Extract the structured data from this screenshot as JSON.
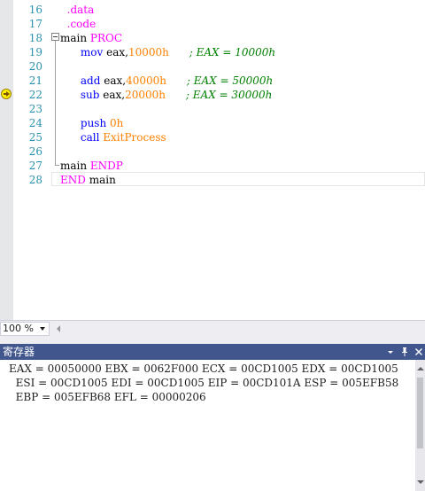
{
  "editor": {
    "lines": [
      {
        "no": "16",
        "parts": [
          {
            "t": "  ",
            "c": "tx"
          },
          {
            "t": ".data",
            "c": "pr"
          }
        ]
      },
      {
        "no": "17",
        "parts": [
          {
            "t": "  ",
            "c": "tx"
          },
          {
            "t": ".code",
            "c": "pr"
          }
        ]
      },
      {
        "no": "18",
        "parts": [
          {
            "t": "main ",
            "c": "tx"
          },
          {
            "t": "PROC",
            "c": "pr"
          }
        ]
      },
      {
        "no": "19",
        "parts": [
          {
            "t": "      ",
            "c": "tx"
          },
          {
            "t": "mov",
            "c": "kw"
          },
          {
            "t": " eax,",
            "c": "tx"
          },
          {
            "t": "10000h",
            "c": "num"
          },
          {
            "t": "      ",
            "c": "tx"
          },
          {
            "t": "; EAX = 10000h",
            "c": "cm"
          }
        ]
      },
      {
        "no": "20",
        "parts": []
      },
      {
        "no": "21",
        "parts": [
          {
            "t": "      ",
            "c": "tx"
          },
          {
            "t": "add",
            "c": "kw"
          },
          {
            "t": " eax,",
            "c": "tx"
          },
          {
            "t": "40000h",
            "c": "num"
          },
          {
            "t": "      ",
            "c": "tx"
          },
          {
            "t": "; EAX = 50000h",
            "c": "cm"
          }
        ]
      },
      {
        "no": "22",
        "parts": [
          {
            "t": "      ",
            "c": "tx"
          },
          {
            "t": "sub",
            "c": "kw"
          },
          {
            "t": " eax,",
            "c": "tx"
          },
          {
            "t": "20000h",
            "c": "num"
          },
          {
            "t": "      ",
            "c": "tx"
          },
          {
            "t": "; EAX = 30000h",
            "c": "cm"
          }
        ]
      },
      {
        "no": "23",
        "parts": []
      },
      {
        "no": "24",
        "parts": [
          {
            "t": "      ",
            "c": "tx"
          },
          {
            "t": "push",
            "c": "kw"
          },
          {
            "t": " ",
            "c": "tx"
          },
          {
            "t": "0h",
            "c": "num"
          }
        ]
      },
      {
        "no": "25",
        "parts": [
          {
            "t": "      ",
            "c": "tx"
          },
          {
            "t": "call",
            "c": "kw"
          },
          {
            "t": " ",
            "c": "tx"
          },
          {
            "t": "ExitProcess",
            "c": "num"
          }
        ]
      },
      {
        "no": "26",
        "parts": []
      },
      {
        "no": "27",
        "parts": [
          {
            "t": "main ",
            "c": "tx"
          },
          {
            "t": "ENDP",
            "c": "pr"
          }
        ]
      },
      {
        "no": "28",
        "parts": [
          {
            "t": "END",
            "c": "pr"
          },
          {
            "t": " main",
            "c": "tx"
          }
        ]
      }
    ],
    "current_line": "22",
    "zoom": "100 %"
  },
  "registers_panel": {
    "title": "寄存器",
    "dropdown_icon": "chevron-down-icon",
    "pin_icon": "pin-icon",
    "close_icon": "close-icon",
    "lines": [
      "EAX = 00050000 EBX = 0062F000 ECX = 00CD1005 EDX = 00CD1005",
      "  ESI = 00CD1005 EDI = 00CD1005 EIP = 00CD101A ESP = 005EFB58",
      "  EBP = 005EFB68 EFL = 00000206"
    ]
  },
  "colors": {
    "keyword": "#0000ff",
    "directive": "#ff00ff",
    "number": "#ff8000",
    "comment": "#008000",
    "line_number": "#2b91af",
    "panel_title_bg": "#40568d"
  }
}
